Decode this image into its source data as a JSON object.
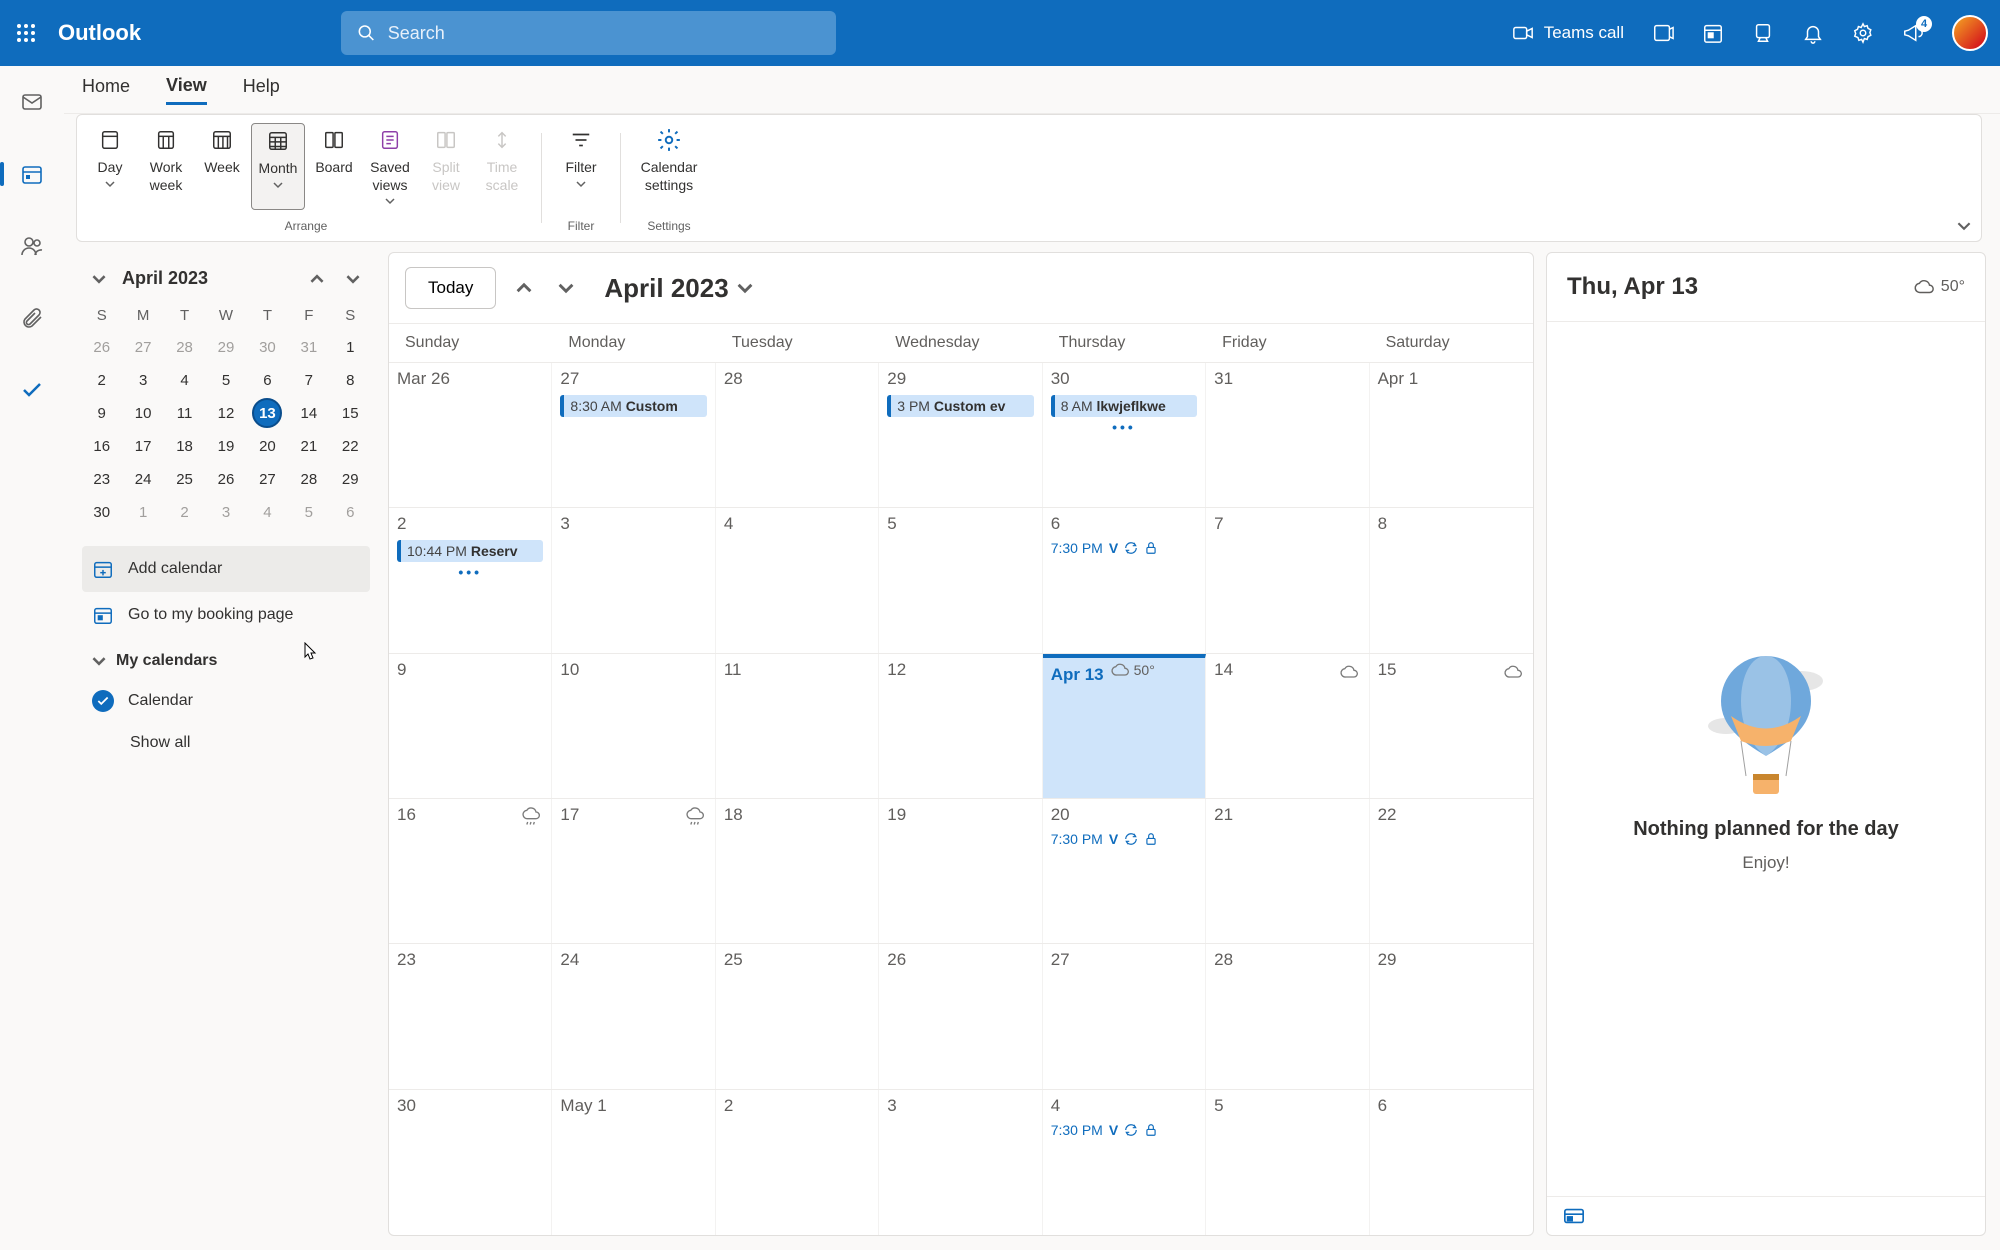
{
  "header": {
    "app_title": "Outlook",
    "search_placeholder": "Search",
    "teams_call": "Teams call",
    "notification_badge": "4"
  },
  "ribbon_tabs": [
    "Home",
    "View",
    "Help"
  ],
  "ribbon_active_tab": 1,
  "ribbon": {
    "arrange": {
      "label": "Arrange",
      "buttons": [
        {
          "label": "Day",
          "dropdown": true
        },
        {
          "label": "Work week"
        },
        {
          "label": "Week"
        },
        {
          "label": "Month",
          "selected": true,
          "dropdown": true
        },
        {
          "label": "Board"
        },
        {
          "label": "Saved views",
          "dropdown": true
        },
        {
          "label": "Split view",
          "disabled": true
        },
        {
          "label": "Time scale",
          "disabled": true
        }
      ]
    },
    "filter": {
      "label_group": "Filter",
      "label": "Filter",
      "dropdown": true
    },
    "settings": {
      "label_group": "Settings",
      "label": "Calendar settings"
    }
  },
  "mini_cal": {
    "title": "April 2023",
    "dow": [
      "S",
      "M",
      "T",
      "W",
      "T",
      "F",
      "S"
    ],
    "weeks": [
      [
        {
          "n": "26",
          "dim": true
        },
        {
          "n": "27",
          "dim": true
        },
        {
          "n": "28",
          "dim": true
        },
        {
          "n": "29",
          "dim": true
        },
        {
          "n": "30",
          "dim": true
        },
        {
          "n": "31",
          "dim": true
        },
        {
          "n": "1"
        }
      ],
      [
        {
          "n": "2"
        },
        {
          "n": "3"
        },
        {
          "n": "4"
        },
        {
          "n": "5"
        },
        {
          "n": "6"
        },
        {
          "n": "7"
        },
        {
          "n": "8"
        }
      ],
      [
        {
          "n": "9"
        },
        {
          "n": "10"
        },
        {
          "n": "11"
        },
        {
          "n": "12"
        },
        {
          "n": "13",
          "today": true
        },
        {
          "n": "14"
        },
        {
          "n": "15"
        }
      ],
      [
        {
          "n": "16"
        },
        {
          "n": "17"
        },
        {
          "n": "18"
        },
        {
          "n": "19"
        },
        {
          "n": "20"
        },
        {
          "n": "21"
        },
        {
          "n": "22"
        }
      ],
      [
        {
          "n": "23"
        },
        {
          "n": "24"
        },
        {
          "n": "25"
        },
        {
          "n": "26"
        },
        {
          "n": "27"
        },
        {
          "n": "28"
        },
        {
          "n": "29"
        }
      ],
      [
        {
          "n": "30"
        },
        {
          "n": "1",
          "dim": true
        },
        {
          "n": "2",
          "dim": true
        },
        {
          "n": "3",
          "dim": true
        },
        {
          "n": "4",
          "dim": true
        },
        {
          "n": "5",
          "dim": true
        },
        {
          "n": "6",
          "dim": true
        }
      ]
    ]
  },
  "side_links": {
    "add_calendar": "Add calendar",
    "booking_page": "Go to my booking page"
  },
  "my_calendars": {
    "title": "My calendars",
    "items": [
      {
        "name": "Calendar",
        "checked": true
      }
    ],
    "show_all": "Show all"
  },
  "calendar": {
    "today_btn": "Today",
    "title": "April 2023",
    "weekdays": [
      "Sunday",
      "Monday",
      "Tuesday",
      "Wednesday",
      "Thursday",
      "Friday",
      "Saturday"
    ],
    "rows": [
      [
        {
          "label": "Mar 26"
        },
        {
          "label": "27",
          "events": [
            {
              "time": "8:30 AM",
              "name": "Custom",
              "style": "chip"
            }
          ]
        },
        {
          "label": "28"
        },
        {
          "label": "29",
          "events": [
            {
              "time": "3 PM",
              "name": "Custom ev",
              "style": "chip"
            }
          ]
        },
        {
          "label": "30",
          "events": [
            {
              "time": "8 AM",
              "name": "lkwjeflkwe",
              "style": "chip"
            }
          ],
          "more": true
        },
        {
          "label": "31"
        },
        {
          "label": "Apr 1"
        }
      ],
      [
        {
          "label": "2",
          "events": [
            {
              "time": "10:44 PM",
              "name": "Reserv",
              "style": "chip"
            }
          ],
          "more": true
        },
        {
          "label": "3"
        },
        {
          "label": "4"
        },
        {
          "label": "5"
        },
        {
          "label": "6",
          "events": [
            {
              "time": "7:30 PM",
              "name": "V",
              "style": "plain",
              "recurring": true,
              "private": true
            }
          ]
        },
        {
          "label": "7"
        },
        {
          "label": "8"
        }
      ],
      [
        {
          "label": "9"
        },
        {
          "label": "10"
        },
        {
          "label": "11"
        },
        {
          "label": "12"
        },
        {
          "label": "Apr 13",
          "today": true,
          "weather": "50°"
        },
        {
          "label": "14",
          "weatherIcon": true
        },
        {
          "label": "15",
          "weatherIcon": true
        }
      ],
      [
        {
          "label": "16",
          "weatherIcon": true
        },
        {
          "label": "17",
          "weatherIcon": true
        },
        {
          "label": "18"
        },
        {
          "label": "19"
        },
        {
          "label": "20",
          "events": [
            {
              "time": "7:30 PM",
              "name": "V",
              "style": "plain",
              "recurring": true,
              "private": true
            }
          ]
        },
        {
          "label": "21"
        },
        {
          "label": "22"
        }
      ],
      [
        {
          "label": "23"
        },
        {
          "label": "24"
        },
        {
          "label": "25"
        },
        {
          "label": "26"
        },
        {
          "label": "27"
        },
        {
          "label": "28"
        },
        {
          "label": "29"
        }
      ],
      [
        {
          "label": "30"
        },
        {
          "label": "May 1"
        },
        {
          "label": "2"
        },
        {
          "label": "3"
        },
        {
          "label": "4",
          "events": [
            {
              "time": "7:30 PM",
              "name": "V",
              "style": "plain",
              "recurring": true,
              "private": true
            }
          ]
        },
        {
          "label": "5"
        },
        {
          "label": "6"
        }
      ]
    ]
  },
  "day_panel": {
    "title": "Thu, Apr 13",
    "weather": "50°",
    "empty_title": "Nothing planned for the day",
    "empty_sub": "Enjoy!"
  },
  "colors": {
    "brand": "#0f6cbd",
    "accent_bg": "#cfe4fa"
  }
}
